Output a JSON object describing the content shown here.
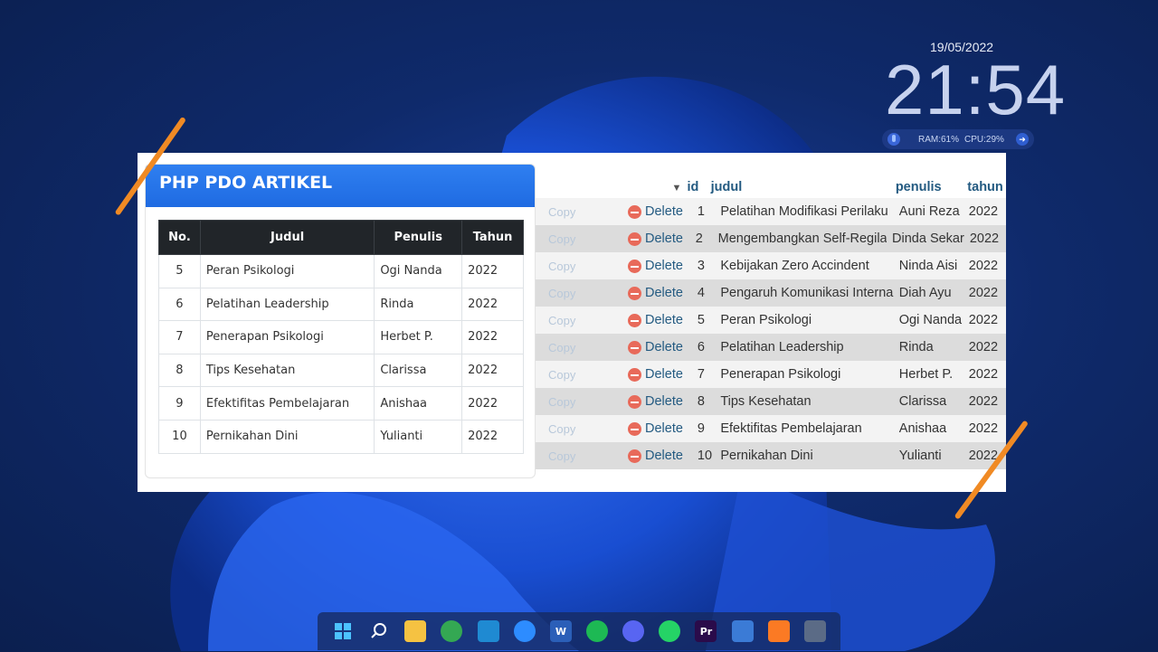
{
  "clock": {
    "date": "19/05/2022",
    "time": "21:54",
    "ram": "RAM:61%",
    "cpu": "CPU:29%"
  },
  "card": {
    "title": "PHP PDO ARTIKEL",
    "headers": [
      "No.",
      "Judul",
      "Penulis",
      "Tahun"
    ],
    "rows": [
      [
        "5",
        "Peran Psikologi",
        "Ogi Nanda",
        "2022"
      ],
      [
        "6",
        "Pelatihan Leadership",
        "Rinda",
        "2022"
      ],
      [
        "7",
        "Penerapan Psikologi",
        "Herbet P.",
        "2022"
      ],
      [
        "8",
        "Tips Kesehatan",
        "Clarissa",
        "2022"
      ],
      [
        "9",
        "Efektifitas Pembelajaran",
        "Anishaa",
        "2022"
      ],
      [
        "10",
        "Pernikahan Dini",
        "Yulianti",
        "2022"
      ]
    ]
  },
  "pma": {
    "headers": {
      "id": "id",
      "judul": "judul",
      "penulis": "penulis",
      "tahun": "tahun"
    },
    "copy_label": "Copy",
    "delete_label": "Delete",
    "rows": [
      {
        "id": "1",
        "judul": "Pelatihan Modifikasi Perilaku",
        "penulis": "Auni Reza",
        "tahun": "2022"
      },
      {
        "id": "2",
        "judul": "Mengembangkan Self-Regilations",
        "penulis": "Dinda Sekar",
        "tahun": "2022"
      },
      {
        "id": "3",
        "judul": "Kebijakan Zero Accindent",
        "penulis": "Ninda Aisi",
        "tahun": "2022"
      },
      {
        "id": "4",
        "judul": "Pengaruh Komunikasi Internal",
        "penulis": "Diah Ayu",
        "tahun": "2022"
      },
      {
        "id": "5",
        "judul": "Peran Psikologi",
        "penulis": "Ogi Nanda",
        "tahun": "2022"
      },
      {
        "id": "6",
        "judul": "Pelatihan Leadership",
        "penulis": "Rinda",
        "tahun": "2022"
      },
      {
        "id": "7",
        "judul": "Penerapan Psikologi",
        "penulis": "Herbet P.",
        "tahun": "2022"
      },
      {
        "id": "8",
        "judul": "Tips Kesehatan",
        "penulis": "Clarissa",
        "tahun": "2022"
      },
      {
        "id": "9",
        "judul": "Efektifitas Pembelajaran",
        "penulis": "Anishaa",
        "tahun": "2022"
      },
      {
        "id": "10",
        "judul": "Pernikahan Dini",
        "penulis": "Yulianti",
        "tahun": "2022"
      }
    ]
  },
  "taskbar": [
    {
      "name": "start-icon",
      "color": "#3aa0ff",
      "glyph": ""
    },
    {
      "name": "search-icon",
      "color": "transparent",
      "glyph": ""
    },
    {
      "name": "file-explorer-icon",
      "color": "#f5c242",
      "glyph": ""
    },
    {
      "name": "chrome-icon",
      "color": "#34a853",
      "glyph": ""
    },
    {
      "name": "vscode-icon",
      "color": "#1f8ad2",
      "glyph": ""
    },
    {
      "name": "zoom-icon",
      "color": "#2d8cff",
      "glyph": ""
    },
    {
      "name": "word-icon",
      "color": "#2b5fb8",
      "glyph": "W"
    },
    {
      "name": "spotify-icon",
      "color": "#1db954",
      "glyph": ""
    },
    {
      "name": "discord-icon",
      "color": "#5865f2",
      "glyph": ""
    },
    {
      "name": "whatsapp-icon",
      "color": "#25d366",
      "glyph": ""
    },
    {
      "name": "premiere-icon",
      "color": "#2a0b4a",
      "glyph": "Pr"
    },
    {
      "name": "remote-desktop-icon",
      "color": "#3b7bd6",
      "glyph": ""
    },
    {
      "name": "xampp-icon",
      "color": "#fb7a24",
      "glyph": ""
    },
    {
      "name": "calculator-icon",
      "color": "#5b6b86",
      "glyph": ""
    }
  ]
}
